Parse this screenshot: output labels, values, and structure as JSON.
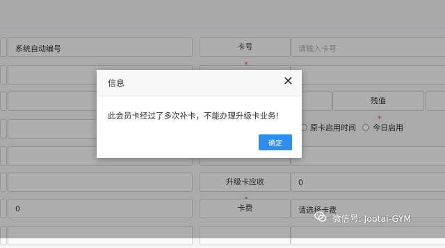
{
  "form": {
    "row1": {
      "auto_number": "系统自动编号",
      "card_number_label": "卡号",
      "card_number_placeholder": "请输入卡号"
    },
    "row3": {
      "remaining_value_label": "残值"
    },
    "row4": {
      "option_original": "原卡启用时间",
      "option_today": "今日启用"
    },
    "row6": {
      "upgrade_due_label": "升级卡应收",
      "upgrade_due_value": "0"
    },
    "row7": {
      "left_value": "0",
      "card_fee_label": "卡费",
      "card_fee_value": "请选择卡费"
    },
    "required_mark": "*"
  },
  "dialog": {
    "title": "信息",
    "close_symbol": "✕",
    "message": "此会员卡经过了多次补卡，不能办理升级卡业务!",
    "confirm_label": "确定"
  },
  "watermark": {
    "text": "微信号: Jootai-GYM",
    "icon": "wechat-icon"
  }
}
